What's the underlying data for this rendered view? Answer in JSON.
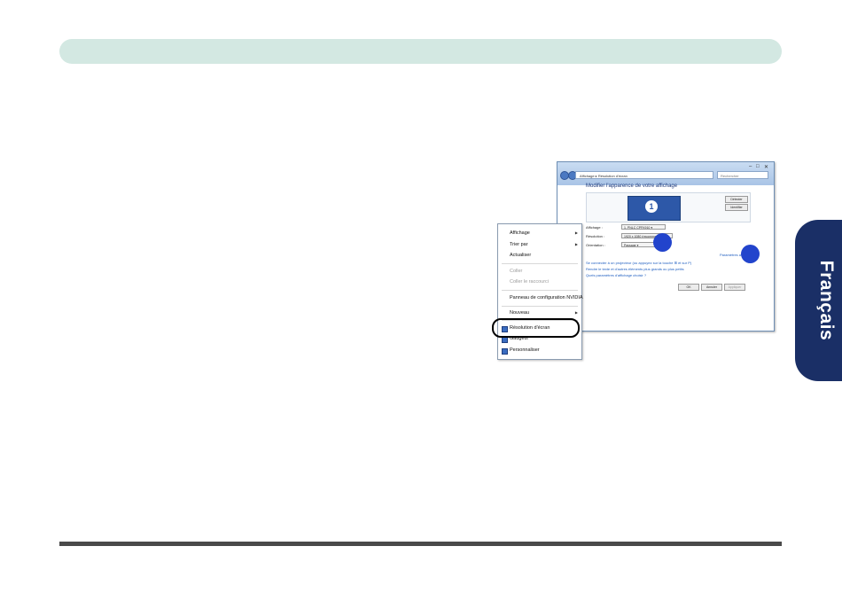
{
  "language_tab": "Français",
  "display_window": {
    "address": "Affichage ▸ Résolution d'écran",
    "search_placeholder": "Rechercher",
    "heading": "Modifier l'apparence de votre affichage",
    "monitor_number": "1",
    "detect_button": "Détecter",
    "identify_button": "Identifier",
    "fields": [
      {
        "label": "Affichage :",
        "value": "1. PNLC CPFK910 ▾"
      },
      {
        "label": "Résolution :",
        "value": "1920 x 1080 (recommandé) ▾"
      },
      {
        "label": "Orientation :",
        "value": "Paysage ▾"
      }
    ],
    "advanced_link": "Paramètres avancés",
    "links": [
      "Se connecter à un projecteur (ou appuyez sur la touche ⊞ et sur P)",
      "Rendre le texte et d'autres éléments plus grands ou plus petits",
      "Quels paramètres d'affichage choisir ?"
    ],
    "buttons": {
      "ok": "OK",
      "cancel": "Annuler",
      "apply": "Appliquer"
    }
  },
  "context_menu": {
    "items": [
      {
        "label": "Affichage",
        "submenu": true
      },
      {
        "label": "Trier par",
        "submenu": true
      },
      {
        "label": "Actualiser"
      },
      {
        "label": "Coller",
        "disabled": true
      },
      {
        "label": "Coller le raccourci",
        "disabled": true
      },
      {
        "label": "Panneau de configuration NVIDIA"
      },
      {
        "label": "Nouveau",
        "submenu": true
      },
      {
        "label": "Résolution d'écran",
        "icon": "display-icon",
        "highlighted": true
      },
      {
        "label": "Gadgets",
        "icon": "gadgets-icon"
      },
      {
        "label": "Personnaliser",
        "icon": "personalize-icon"
      }
    ]
  }
}
